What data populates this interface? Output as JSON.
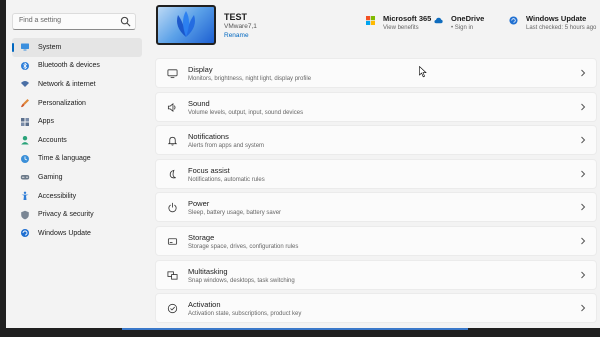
{
  "search": {
    "placeholder": "Find a setting"
  },
  "sidebar": {
    "items": [
      {
        "label": "System",
        "icon": "monitor-icon"
      },
      {
        "label": "Bluetooth & devices",
        "icon": "bluetooth-icon"
      },
      {
        "label": "Network & internet",
        "icon": "wifi-icon"
      },
      {
        "label": "Personalization",
        "icon": "brush-icon"
      },
      {
        "label": "Apps",
        "icon": "apps-icon"
      },
      {
        "label": "Accounts",
        "icon": "person-icon"
      },
      {
        "label": "Time & language",
        "icon": "globe-clock-icon"
      },
      {
        "label": "Gaming",
        "icon": "gamepad-icon"
      },
      {
        "label": "Accessibility",
        "icon": "accessibility-icon"
      },
      {
        "label": "Privacy & security",
        "icon": "shield-icon"
      },
      {
        "label": "Windows Update",
        "icon": "update-icon"
      }
    ]
  },
  "device": {
    "name": "TEST",
    "model": "VMware7,1",
    "rename": "Rename"
  },
  "header": {
    "ms365": {
      "title": "Microsoft 365",
      "sub": "View benefits"
    },
    "onedrive": {
      "title": "OneDrive",
      "sub": "• Sign in"
    },
    "update": {
      "title": "Windows Update",
      "sub": "Last checked: 5 hours ago"
    }
  },
  "cards": [
    {
      "title": "Display",
      "sub": "Monitors, brightness, night light, display profile",
      "icon": "display-icon"
    },
    {
      "title": "Sound",
      "sub": "Volume levels, output, input, sound devices",
      "icon": "speaker-icon"
    },
    {
      "title": "Notifications",
      "sub": "Alerts from apps and system",
      "icon": "bell-icon"
    },
    {
      "title": "Focus assist",
      "sub": "Notifications, automatic rules",
      "icon": "moon-icon"
    },
    {
      "title": "Power",
      "sub": "Sleep, battery usage, battery saver",
      "icon": "power-icon"
    },
    {
      "title": "Storage",
      "sub": "Storage space, drives, configuration rules",
      "icon": "storage-icon"
    },
    {
      "title": "Multitasking",
      "sub": "Snap windows, desktops, task switching",
      "icon": "multitasking-icon"
    },
    {
      "title": "Activation",
      "sub": "Activation state, subscriptions, product key",
      "icon": "check-circle-icon"
    }
  ],
  "colors": {
    "accent": "#0067c0",
    "window_bg": "#f3f3f3",
    "card_bg": "#fbfbfb"
  }
}
